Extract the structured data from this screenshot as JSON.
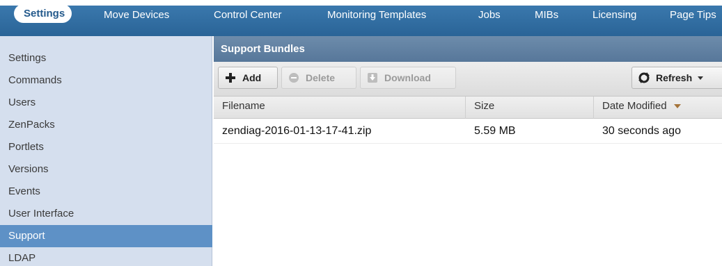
{
  "topnav": {
    "items": [
      {
        "label": "Settings",
        "active": true
      },
      {
        "label": "Move Devices"
      },
      {
        "label": "Control Center"
      },
      {
        "label": "Monitoring Templates"
      },
      {
        "label": "Jobs"
      },
      {
        "label": "MIBs"
      },
      {
        "label": "Licensing"
      },
      {
        "label": "Page Tips"
      }
    ]
  },
  "sidebar": {
    "items": [
      {
        "label": "Settings"
      },
      {
        "label": "Commands"
      },
      {
        "label": "Users"
      },
      {
        "label": "ZenPacks"
      },
      {
        "label": "Portlets"
      },
      {
        "label": "Versions"
      },
      {
        "label": "Events"
      },
      {
        "label": "User Interface"
      },
      {
        "label": "Support",
        "active": true
      },
      {
        "label": "LDAP"
      }
    ]
  },
  "panel": {
    "title": "Support Bundles"
  },
  "toolbar": {
    "add_label": "Add",
    "delete_label": "Delete",
    "download_label": "Download",
    "refresh_label": "Refresh"
  },
  "grid": {
    "columns": [
      "Filename",
      "Size",
      "Date Modified"
    ],
    "rows": [
      {
        "filename": "zendiag-2016-01-13-17-41.zip",
        "size": "5.59 MB",
        "modified": "30 seconds ago"
      }
    ]
  },
  "colors": {
    "nav_blue": "#2f6ca3",
    "sidebar_bg": "#d5dfee",
    "sidebar_active": "#5e91c6",
    "panel_header": "#617f9f"
  },
  "icons": {
    "add": "plus-icon",
    "delete": "minus-circle-icon",
    "download": "download-icon",
    "refresh": "refresh-icon",
    "sort": "sort-desc-icon"
  }
}
